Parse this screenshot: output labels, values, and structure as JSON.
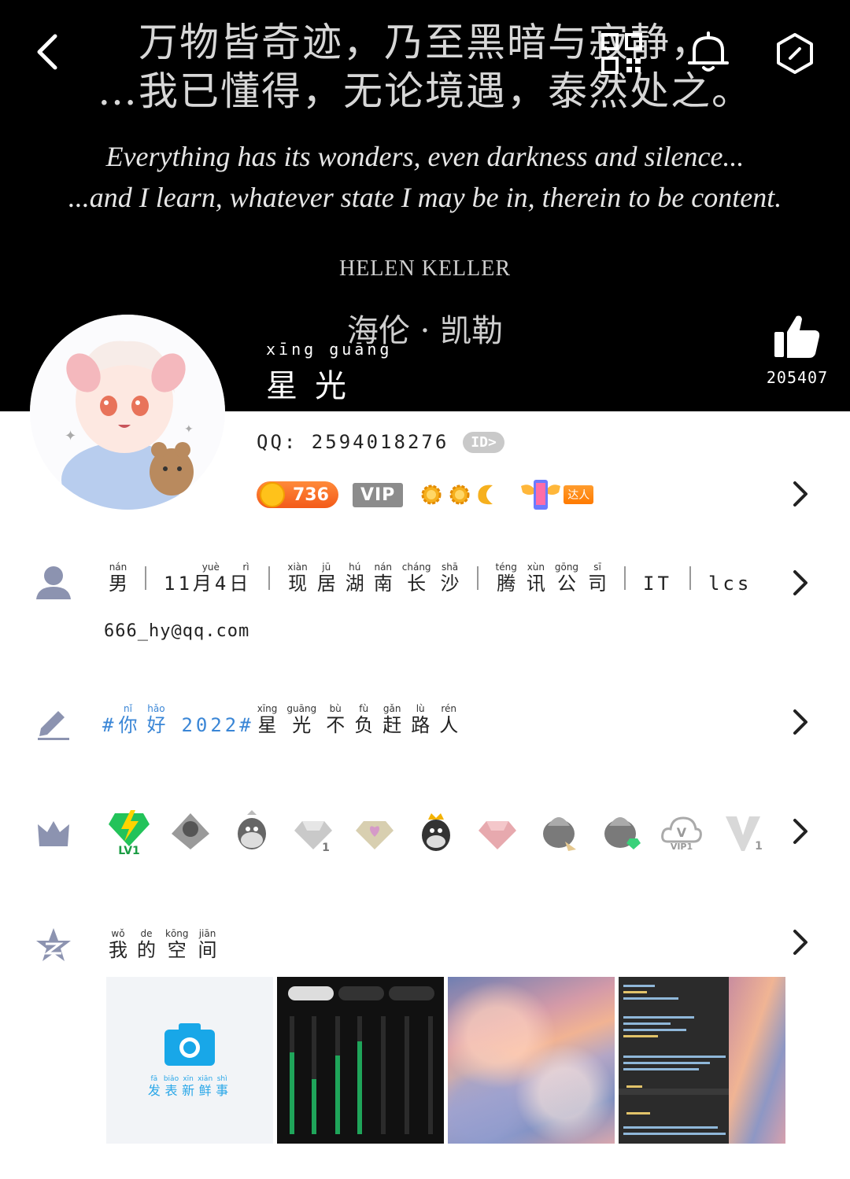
{
  "cover": {
    "quote_zh_line1": "万物皆奇迹，乃至黑暗与寂静，",
    "quote_zh_line2": "…我已懂得，无论境遇，泰然处之。",
    "quote_en_line1": "Everything has its wonders, even darkness and silence...",
    "quote_en_line2": "...and I learn, whatever state I may be in, therein to be content.",
    "author_en": "HELEN KELLER",
    "author_zh": "海伦 · 凯勒"
  },
  "header": {
    "icons": [
      "back-icon",
      "qr-code-icon",
      "bell-icon",
      "settings-icon"
    ]
  },
  "profile": {
    "nickname_pinyin": "xīng guāng",
    "nickname": "星光",
    "like_count": "205407",
    "qq_label": "QQ: 2594018276",
    "id_badge": "ID>",
    "coin_count": "736",
    "vip_label": "VIP",
    "daren_label": "达人"
  },
  "details": {
    "gender": {
      "py": "nán",
      "hz": "男"
    },
    "birthday": "11月4日",
    "birthday_py": [
      "",
      "",
      "yuè",
      "",
      "rì"
    ],
    "location": [
      {
        "py": "xiàn",
        "hz": "现"
      },
      {
        "py": "jū",
        "hz": "居"
      },
      {
        "py": "hú",
        "hz": "湖"
      },
      {
        "py": "nán",
        "hz": "南"
      },
      {
        "py": "cháng",
        "hz": "长"
      },
      {
        "py": "shā",
        "hz": "沙"
      }
    ],
    "company": [
      {
        "py": "téng",
        "hz": "腾"
      },
      {
        "py": "xùn",
        "hz": "讯"
      },
      {
        "py": "gōng",
        "hz": "公"
      },
      {
        "py": "sī",
        "hz": "司"
      }
    ],
    "occupation": "IT",
    "other": "lcs",
    "email": "666_hy@qq.com"
  },
  "signature": {
    "hash1": "#",
    "ni": {
      "py": "nǐ",
      "hz": "你"
    },
    "hao": {
      "py": "hǎo",
      "hz": "好"
    },
    "year_tag": "2022#",
    "rest": [
      {
        "py": "xīng",
        "hz": "星"
      },
      {
        "py": "guāng",
        "hz": "光"
      },
      {
        "py": "bù",
        "hz": "不"
      },
      {
        "py": "fù",
        "hz": "负"
      },
      {
        "py": "gǎn",
        "hz": "赶"
      },
      {
        "py": "lù",
        "hz": "路"
      },
      {
        "py": "rén",
        "hz": "人"
      }
    ]
  },
  "medals": {
    "level_label": "LV1",
    "vip_label": "VIP1",
    "vip_num": "1",
    "diamond_num": "1"
  },
  "space": {
    "title": [
      {
        "py": "wǒ",
        "hz": "我"
      },
      {
        "py": "de",
        "hz": "的"
      },
      {
        "py": "kōng",
        "hz": "空"
      },
      {
        "py": "jiān",
        "hz": "间"
      }
    ],
    "upload_label": [
      {
        "py": "fā",
        "hz": "发"
      },
      {
        "py": "biǎo",
        "hz": "表"
      },
      {
        "py": "xīn",
        "hz": "新"
      },
      {
        "py": "xiān",
        "hz": "鲜"
      },
      {
        "py": "shì",
        "hz": "事"
      }
    ]
  },
  "colors": {
    "accent_blue": "#3a86d6",
    "section_icon_gray": "#8c93b0",
    "coin_orange": "#f35a19"
  }
}
